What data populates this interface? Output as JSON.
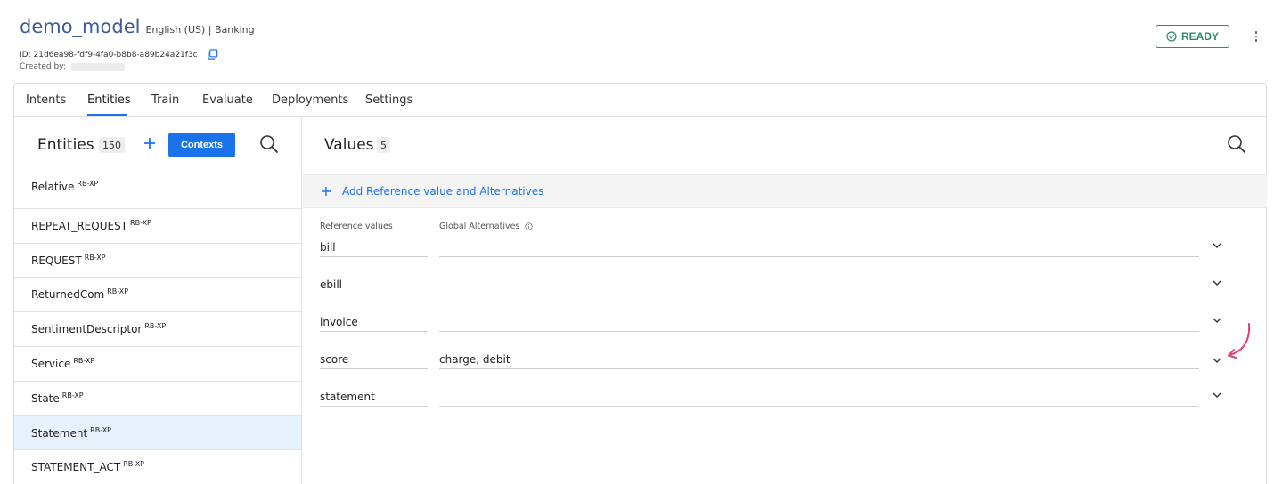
{
  "header": {
    "model_name": "demo_model",
    "model_meta": "English (US) | Banking",
    "id_label": "ID:",
    "id_value": "21d6ea98-fdf9-4fa0-b8b8-a89b24a21f3c",
    "created_by_label": "Created by:",
    "status_label": "READY"
  },
  "tabs": [
    {
      "label": "Intents"
    },
    {
      "label": "Entities"
    },
    {
      "label": "Train"
    },
    {
      "label": "Evaluate"
    },
    {
      "label": "Deployments"
    },
    {
      "label": "Settings"
    }
  ],
  "active_tab": "Entities",
  "entities_panel": {
    "title": "Entities",
    "count": "150",
    "contexts_label": "Contexts",
    "items": [
      {
        "name": "Relative",
        "tag": "RB-XP"
      },
      {
        "name": "REPEAT_REQUEST",
        "tag": "RB-XP"
      },
      {
        "name": "REQUEST",
        "tag": "RB-XP"
      },
      {
        "name": "ReturnedCom",
        "tag": "RB-XP"
      },
      {
        "name": "SentimentDescriptor",
        "tag": "RB-XP"
      },
      {
        "name": "Service",
        "tag": "RB-XP"
      },
      {
        "name": "State",
        "tag": "RB-XP"
      },
      {
        "name": "Statement",
        "tag": "RB-XP"
      },
      {
        "name": "STATEMENT_ACT",
        "tag": "RB-XP"
      }
    ],
    "selected": "Statement"
  },
  "values_panel": {
    "title": "Values",
    "count": "5",
    "add_label": "Add Reference value and Alternatives",
    "col_reference": "Reference values",
    "col_alternatives": "Global Alternatives",
    "rows": [
      {
        "reference": "bill",
        "alternatives": ""
      },
      {
        "reference": "ebill",
        "alternatives": ""
      },
      {
        "reference": "invoice",
        "alternatives": ""
      },
      {
        "reference": "score",
        "alternatives": "charge, debit"
      },
      {
        "reference": "statement",
        "alternatives": ""
      }
    ]
  },
  "colors": {
    "primary": "#1a73e8",
    "ready": "#2e8b6e",
    "title": "#3d5a99",
    "selected_row": "#e8f0fb",
    "annotation_arrow": "#e0407a"
  },
  "icons": [
    "copy-icon",
    "check-circle-icon",
    "more-vertical-icon",
    "plus-icon",
    "search-icon",
    "info-icon",
    "chevron-down-icon",
    "curved-arrow-annotation"
  ]
}
